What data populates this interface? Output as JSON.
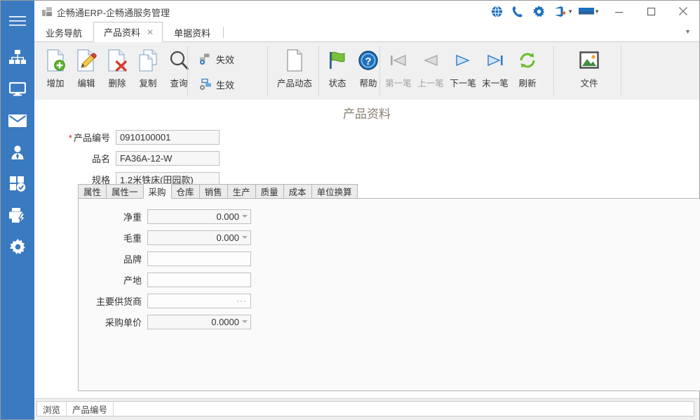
{
  "colors": {
    "rail": "#3a7ac0",
    "accent": "#1d6fbf",
    "required": "#d02020",
    "page_title": "#8a7f72"
  },
  "titlebar": {
    "title": "企畅通ERP-企畅通服务管理",
    "icons": [
      {
        "name": "globe-icon",
        "label": "网络"
      },
      {
        "name": "phone-icon",
        "label": "电话"
      },
      {
        "name": "gear-icon",
        "label": "设置"
      },
      {
        "name": "office-icon",
        "label": "办公"
      },
      {
        "name": "flag-icon",
        "label": "语言"
      }
    ],
    "window_controls": [
      {
        "name": "minimize-button",
        "label": "最小化"
      },
      {
        "name": "maximize-button",
        "label": "最大化"
      },
      {
        "name": "close-button",
        "label": "关闭"
      }
    ]
  },
  "tabstrip": {
    "tabs": [
      {
        "label": "业务导航",
        "active": false,
        "closable": false
      },
      {
        "label": "产品资料",
        "active": true,
        "closable": true
      },
      {
        "label": "单据资料",
        "active": false,
        "closable": false
      }
    ],
    "close_glyph": "✕",
    "overflow_caret": "▼"
  },
  "sidebar": {
    "items": [
      {
        "name": "menu-icon",
        "label": "菜单"
      },
      {
        "name": "sitemap-icon",
        "label": "组织架构"
      },
      {
        "name": "monitor-icon",
        "label": "监控"
      },
      {
        "name": "mail-icon",
        "label": "邮件"
      },
      {
        "name": "user-icon",
        "label": "用户"
      },
      {
        "name": "apps-check-icon",
        "label": "应用"
      },
      {
        "name": "print-icon",
        "label": "打印"
      },
      {
        "name": "settings-gear-icon",
        "label": "设置"
      }
    ]
  },
  "ribbon": {
    "groups": [
      {
        "name": "record-actions",
        "buttons": [
          {
            "label": "增加",
            "icon": "file-add-icon",
            "enabled": true
          },
          {
            "label": "编辑",
            "icon": "file-edit-icon",
            "enabled": true
          },
          {
            "label": "删除",
            "icon": "file-delete-icon",
            "enabled": true
          },
          {
            "label": "复制",
            "icon": "file-copy-icon",
            "enabled": true
          },
          {
            "label": "查询",
            "icon": "search-icon",
            "enabled": true
          }
        ]
      },
      {
        "name": "state-actions",
        "buttons": [
          {
            "label": "失效",
            "icon": "network-disable-icon",
            "enabled": true
          },
          {
            "label": "生效",
            "icon": "network-enable-icon",
            "enabled": true
          }
        ]
      },
      {
        "name": "dynamic-actions",
        "buttons": [
          {
            "label": "产品动态",
            "icon": "document-icon",
            "enabled": true
          }
        ]
      },
      {
        "name": "info-actions",
        "buttons": [
          {
            "label": "状态",
            "icon": "flag-green-icon",
            "enabled": true
          },
          {
            "label": "帮助",
            "icon": "help-question-icon",
            "enabled": true
          }
        ]
      },
      {
        "name": "navigation-actions",
        "buttons": [
          {
            "label": "第一笔",
            "icon": "first-record-icon",
            "enabled": false
          },
          {
            "label": "上一笔",
            "icon": "prev-record-icon",
            "enabled": false
          },
          {
            "label": "下一笔",
            "icon": "next-record-icon",
            "enabled": true
          },
          {
            "label": "末一笔",
            "icon": "last-record-icon",
            "enabled": true
          },
          {
            "label": "刷新",
            "icon": "refresh-icon",
            "enabled": true
          }
        ]
      },
      {
        "name": "file-actions",
        "buttons": [
          {
            "label": "文件",
            "icon": "image-file-icon",
            "enabled": true
          }
        ]
      }
    ]
  },
  "page": {
    "title": "产品资料",
    "header_fields": [
      {
        "label": "产品编号",
        "value": "0910100001",
        "required": true,
        "type": "text"
      },
      {
        "label": "品名",
        "value": "FA36A-12-W",
        "required": false,
        "type": "text"
      },
      {
        "label": "规格",
        "value": "1.2米铁床(田园款)",
        "required": false,
        "type": "text"
      }
    ],
    "inner_tabs": [
      {
        "label": "属性",
        "active": false
      },
      {
        "label": "属性一",
        "active": false
      },
      {
        "label": "采购",
        "active": true
      },
      {
        "label": "仓库",
        "active": false
      },
      {
        "label": "销售",
        "active": false
      },
      {
        "label": "生产",
        "active": false
      },
      {
        "label": "质量",
        "active": false
      },
      {
        "label": "成本",
        "active": false
      },
      {
        "label": "单位换算",
        "active": false
      }
    ],
    "purchase_fields": [
      {
        "label": "净重",
        "value": "0.000",
        "type": "spinner"
      },
      {
        "label": "毛重",
        "value": "0.000",
        "type": "spinner"
      },
      {
        "label": "品牌",
        "value": "",
        "type": "text"
      },
      {
        "label": "产地",
        "value": "",
        "type": "text"
      },
      {
        "label": "主要供货商",
        "value": "",
        "type": "lookup",
        "button": "···"
      },
      {
        "label": "采购单价",
        "value": "0.0000",
        "type": "spinner"
      }
    ]
  },
  "statusbar": {
    "cells": [
      {
        "label": "浏览"
      },
      {
        "label": "产品编号"
      }
    ]
  }
}
